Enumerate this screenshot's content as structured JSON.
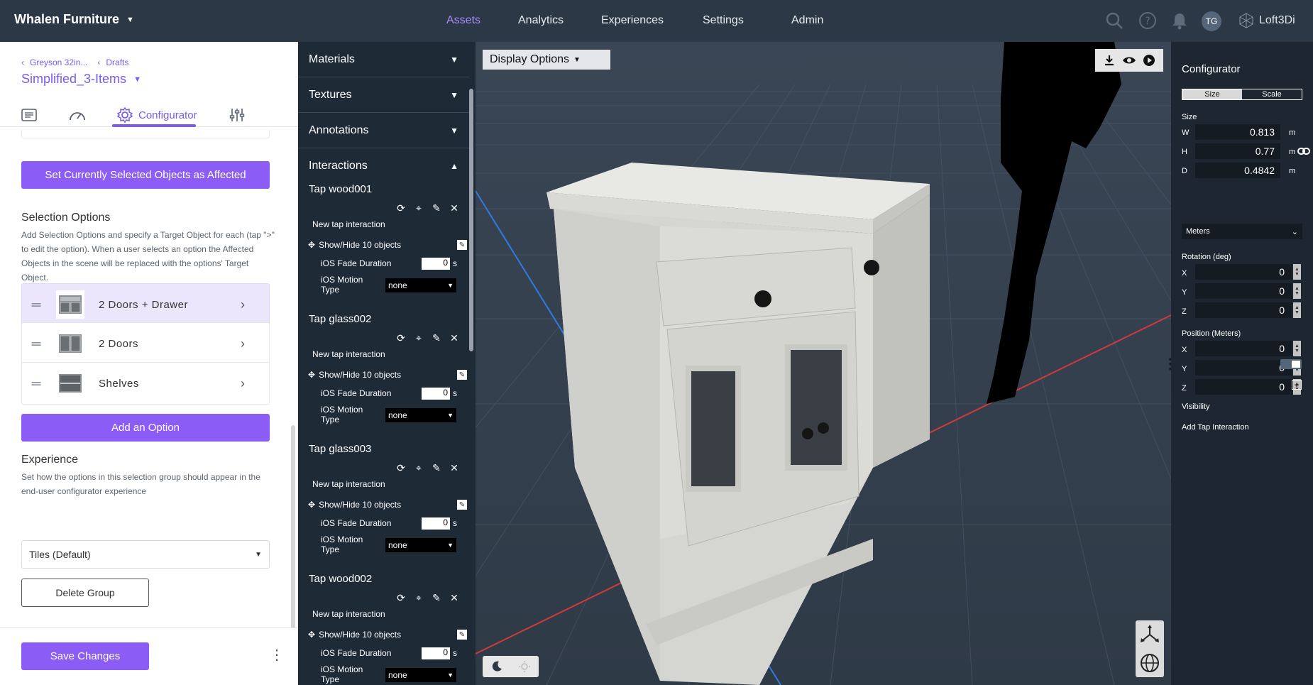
{
  "topbar": {
    "brand": "Whalen Furniture",
    "nav": [
      "Assets",
      "Analytics",
      "Experiences",
      "Settings",
      "Admin"
    ],
    "active_nav": "Assets",
    "avatar_initials": "TG",
    "product_name": "Loft3Di"
  },
  "left": {
    "breadcrumb": [
      "Greyson 32in...",
      "Drafts"
    ],
    "asset_title": "Simplified_3-Items",
    "tabs": [
      {
        "icon": "document-icon",
        "label": ""
      },
      {
        "icon": "gauge-icon",
        "label": ""
      },
      {
        "icon": "gear-icon",
        "label": "Configurator"
      },
      {
        "icon": "sliders-icon",
        "label": ""
      }
    ],
    "set_affected_button": "Set Currently Selected Objects as Affected",
    "selection_heading": "Selection Options",
    "selection_desc": "Add Selection Options and specify a Target Object for each (tap \">\" to edit the option). When a user selects an option the Affected Objects in the scene will be replaced with the options' Target Object.",
    "options": [
      {
        "label": "2 Doors + Drawer",
        "selected": true
      },
      {
        "label": "2 Doors",
        "selected": false
      },
      {
        "label": "Shelves",
        "selected": false
      }
    ],
    "add_option_button": "Add an Option",
    "experience_heading": "Experience",
    "experience_desc": "Set how the options in this selection group should appear in the end-user configurator experience",
    "experience_value": "Tiles (Default)",
    "delete_group_button": "Delete Group",
    "save_button": "Save Changes"
  },
  "middle": {
    "accordions": [
      "Materials",
      "Textures",
      "Annotations",
      "Interactions"
    ],
    "interactions": [
      {
        "title": "Tap wood001"
      },
      {
        "title": "Tap glass002"
      },
      {
        "title": "Tap glass003"
      },
      {
        "title": "Tap wood002"
      }
    ],
    "new_tap_label": "New tap interaction",
    "show_hide_label": "Show/Hide 10 objects",
    "fade_label": "iOS Fade Duration",
    "fade_value": "0",
    "fade_unit": "s",
    "motion_label": "iOS Motion Type",
    "motion_value": "none"
  },
  "viewport": {
    "display_options": "Display Options"
  },
  "right": {
    "title": "Configurator",
    "seg": [
      "Size",
      "Scale"
    ],
    "size_label": "Size",
    "size": [
      {
        "axis": "W",
        "value": "0.813",
        "unit": "m"
      },
      {
        "axis": "H",
        "value": "0.77",
        "unit": "m"
      },
      {
        "axis": "D",
        "value": "0.4842",
        "unit": "m"
      }
    ],
    "unit_select": "Meters",
    "rotation_label": "Rotation (deg)",
    "rotation": [
      {
        "axis": "X",
        "value": "0"
      },
      {
        "axis": "Y",
        "value": "0"
      },
      {
        "axis": "Z",
        "value": "0"
      }
    ],
    "position_label": "Position (Meters)",
    "position": [
      {
        "axis": "X",
        "value": "0"
      },
      {
        "axis": "Y",
        "value": "0"
      },
      {
        "axis": "Z",
        "value": "0"
      }
    ],
    "visibility_label": "Visibility",
    "add_tap_label": "Add Tap Interaction"
  },
  "colors": {
    "accent": "#8b5cf6",
    "topbar": "#2c3845",
    "panel_dark": "#1f2a37"
  }
}
